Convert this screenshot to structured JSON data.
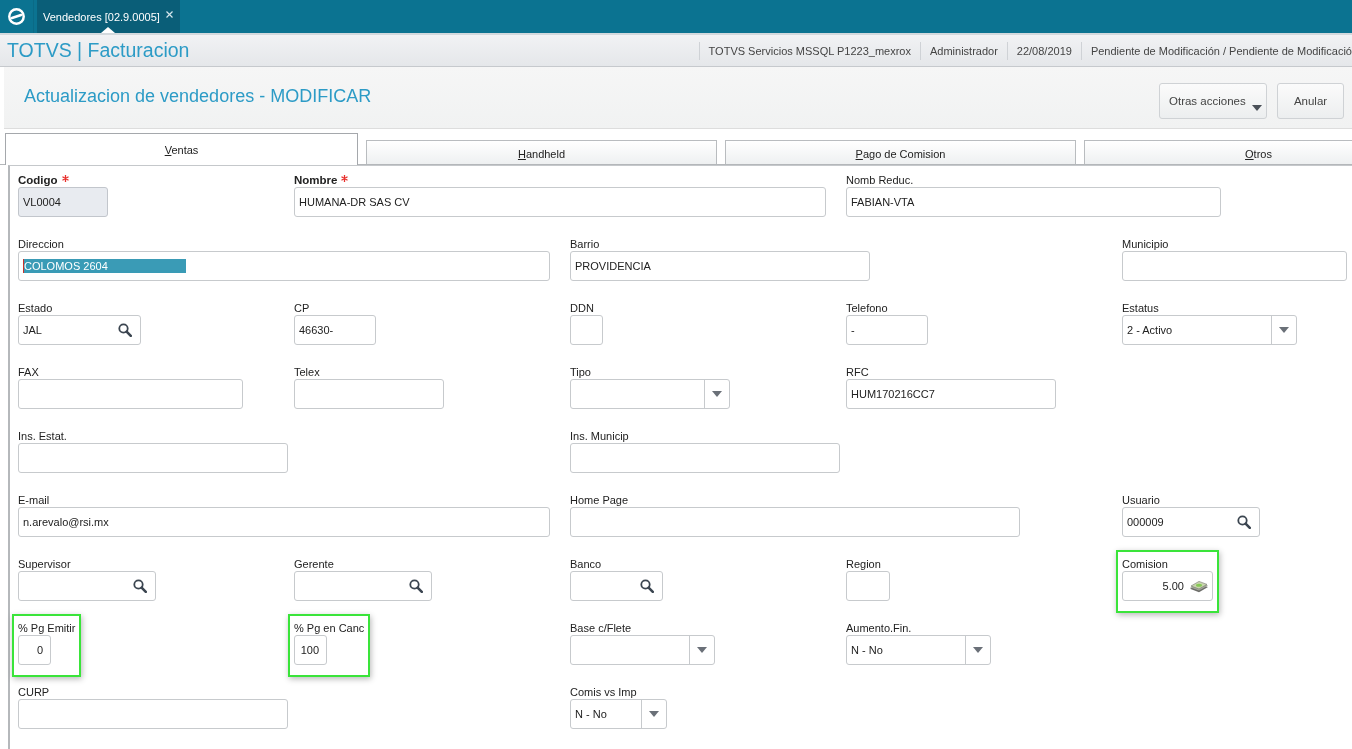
{
  "top_bar": {
    "tabs": [
      {
        "label": "Vendedores [02.9.0005]",
        "selected": true
      }
    ]
  },
  "header": {
    "title": "TOTVS | Facturacion",
    "info": [
      "TOTVS Servicios MSSQL P1223_mexrox",
      "Administrador",
      "22/08/2019",
      "Pendiente de Modificación / Pendiente de Modificació"
    ]
  },
  "page": {
    "title": "Actualizacion de vendedores - MODIFICAR",
    "buttons": [
      {
        "label": "Otras acciones",
        "kind": "menu"
      },
      {
        "label": "Anular",
        "kind": "plain"
      }
    ]
  },
  "tabs": [
    {
      "label": "Ventas",
      "selected": true
    },
    {
      "label": "Handheld",
      "selected": false
    },
    {
      "label": "Pago de Comision",
      "selected": false
    },
    {
      "label": "Otros",
      "selected": false
    }
  ],
  "form": {
    "rows": [
      {
        "fields": [
          {
            "label": "Codigo",
            "kind": "text",
            "value": "VL0004",
            "required": true,
            "disabled": true,
            "text_selected": false,
            "highlighted": false
          },
          {
            "label": "Nombre",
            "kind": "text",
            "value": "HUMANA-DR SAS CV",
            "required": true,
            "disabled": false,
            "text_selected": false,
            "highlighted": false
          },
          {
            "label": "Nomb Reduc.",
            "kind": "text",
            "value": "FABIAN-VTA",
            "required": false,
            "disabled": false,
            "text_selected": false,
            "highlighted": false
          }
        ]
      },
      {
        "fields": [
          {
            "label": "Direccion",
            "kind": "text",
            "value": "COLOMOS 2604",
            "required": false,
            "disabled": false,
            "text_selected": true,
            "highlighted": false
          },
          {
            "label": "Barrio",
            "kind": "text",
            "value": "PROVIDENCIA",
            "required": false,
            "disabled": false,
            "text_selected": false,
            "highlighted": false
          },
          {
            "label": "Municipio",
            "kind": "text",
            "required": false,
            "disabled": false,
            "text_selected": false,
            "highlighted": false
          }
        ]
      },
      {
        "fields": [
          {
            "label": "Estado",
            "kind": "search",
            "value": "JAL",
            "required": false,
            "disabled": false,
            "text_selected": false,
            "highlighted": false
          },
          {
            "label": "CP",
            "kind": "text",
            "value": "46630-",
            "required": false,
            "disabled": false,
            "text_selected": false,
            "highlighted": false
          },
          {
            "label": "DDN",
            "kind": "text",
            "required": false,
            "disabled": false,
            "text_selected": false,
            "highlighted": false
          },
          {
            "label": "Telefono",
            "kind": "text",
            "value": "-",
            "required": false,
            "disabled": false,
            "text_selected": false,
            "highlighted": false
          },
          {
            "label": "Estatus",
            "kind": "select",
            "value": "2 - Activo",
            "required": false,
            "disabled": false,
            "text_selected": false,
            "highlighted": false
          }
        ]
      },
      {
        "fields": [
          {
            "label": "FAX",
            "kind": "text",
            "required": false,
            "disabled": false,
            "text_selected": false,
            "highlighted": false
          },
          {
            "label": "Telex",
            "kind": "text",
            "required": false,
            "disabled": false,
            "text_selected": false,
            "highlighted": false
          },
          {
            "label": "Tipo",
            "kind": "select",
            "required": false,
            "disabled": false,
            "text_selected": false,
            "highlighted": false
          },
          {
            "label": "RFC",
            "kind": "text",
            "value": "HUM170216CC7",
            "required": false,
            "disabled": false,
            "text_selected": false,
            "highlighted": false
          }
        ]
      },
      {
        "fields": [
          {
            "label": "Ins. Estat.",
            "kind": "text",
            "required": false,
            "disabled": false,
            "text_selected": false,
            "highlighted": false
          },
          {
            "label": "Ins. Municip",
            "kind": "text",
            "required": false,
            "disabled": false,
            "text_selected": false,
            "highlighted": false
          }
        ]
      },
      {
        "fields": [
          {
            "label": "E-mail",
            "kind": "text",
            "value": "n.arevalo@rsi.mx",
            "required": false,
            "disabled": false,
            "text_selected": false,
            "highlighted": false
          },
          {
            "label": "Home Page",
            "kind": "text",
            "required": false,
            "disabled": false,
            "text_selected": false,
            "highlighted": false
          },
          {
            "label": "Usuario",
            "kind": "search",
            "value": "000009",
            "required": false,
            "disabled": false,
            "text_selected": false,
            "highlighted": false
          }
        ]
      },
      {
        "fields": [
          {
            "label": "Supervisor",
            "kind": "search",
            "required": false,
            "disabled": false,
            "text_selected": false,
            "highlighted": false
          },
          {
            "label": "Gerente",
            "kind": "search",
            "required": false,
            "disabled": false,
            "text_selected": false,
            "highlighted": false
          },
          {
            "label": "Banco",
            "kind": "search",
            "required": false,
            "disabled": false,
            "text_selected": false,
            "highlighted": false
          },
          {
            "label": "Region",
            "kind": "text",
            "required": false,
            "disabled": false,
            "text_selected": false,
            "highlighted": false
          },
          {
            "label": "Comision",
            "kind": "currency",
            "value": "5.00",
            "required": false,
            "disabled": false,
            "text_selected": false,
            "highlighted": true
          }
        ]
      },
      {
        "fields": [
          {
            "label": "% Pg Emitir",
            "kind": "number",
            "value": "0",
            "required": false,
            "disabled": false,
            "text_selected": false,
            "highlighted": true
          },
          {
            "label": "% Pg en Canc",
            "kind": "number",
            "value": "100",
            "required": false,
            "disabled": false,
            "text_selected": false,
            "highlighted": true
          },
          {
            "label": "Base c/Flete",
            "kind": "select",
            "required": false,
            "disabled": false,
            "text_selected": false,
            "highlighted": false
          },
          {
            "label": "Aumento.Fin.",
            "kind": "select",
            "value": "N - No",
            "required": false,
            "disabled": false,
            "text_selected": false,
            "highlighted": false
          }
        ]
      },
      {
        "fields": [
          {
            "label": "CURP",
            "kind": "text",
            "required": false,
            "disabled": false,
            "text_selected": false,
            "highlighted": false
          },
          {
            "label": "Comis vs Imp",
            "kind": "select",
            "value": "N - No",
            "required": false,
            "disabled": false,
            "text_selected": false,
            "highlighted": false
          }
        ]
      }
    ]
  }
}
